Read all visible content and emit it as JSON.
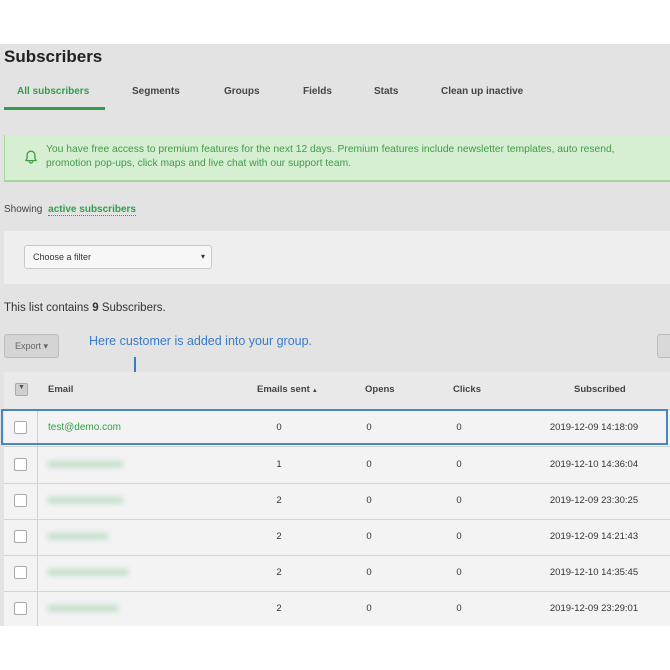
{
  "page": {
    "title": "Subscribers"
  },
  "tabs": [
    {
      "label": "All subscribers",
      "active": true
    },
    {
      "label": "Segments"
    },
    {
      "label": "Groups"
    },
    {
      "label": "Fields"
    },
    {
      "label": "Stats"
    },
    {
      "label": "Clean up inactive"
    }
  ],
  "banner": {
    "icon": "bell-icon",
    "text": "You have free access to premium features for the next 12 days. Premium features include newsletter templates, auto resend, promotion pop-ups, click maps and live chat with our support team."
  },
  "showing": {
    "prefix": "Showing",
    "link": "active subscribers"
  },
  "filter": {
    "selected": "Choose a filter",
    "caret": "▾"
  },
  "list_summary": {
    "prefix": "This list contains",
    "count": "9",
    "suffix": "Subscribers."
  },
  "toolbar": {
    "export_label": "Export ▾"
  },
  "annotation": {
    "text": "Here customer is added into your group."
  },
  "table": {
    "columns": {
      "email": "Email",
      "emails_sent": "Emails sent",
      "sort_indicator": "▲",
      "opens": "Opens",
      "clicks": "Clicks",
      "subscribed": "Subscribed"
    },
    "rows": [
      {
        "email": "test@demo.com",
        "sent": "0",
        "opens": "0",
        "clicks": "0",
        "subscribed": "2019-12-09 14:18:09"
      },
      {
        "email": "xxxxxxxxxxxxxxx",
        "sent": "1",
        "opens": "0",
        "clicks": "0",
        "subscribed": "2019-12-10 14:36:04"
      },
      {
        "email": "xxxxxxxxxxxxxxx",
        "sent": "2",
        "opens": "0",
        "clicks": "0",
        "subscribed": "2019-12-09 23:30:25"
      },
      {
        "email": "xxxxxxxxxxxx",
        "sent": "2",
        "opens": "0",
        "clicks": "0",
        "subscribed": "2019-12-09 14:21:43"
      },
      {
        "email": "xxxxxxxxxxxxxxxx",
        "sent": "2",
        "opens": "0",
        "clicks": "0",
        "subscribed": "2019-12-10 14:35:45"
      },
      {
        "email": "xxxxxxxxxxxxxx",
        "sent": "2",
        "opens": "0",
        "clicks": "0",
        "subscribed": "2019-12-09 23:29:01"
      }
    ]
  },
  "colors": {
    "accent_green": "#2f9e4a",
    "banner_bg": "#d6eed2",
    "annotation_blue": "#3a7bc8"
  }
}
